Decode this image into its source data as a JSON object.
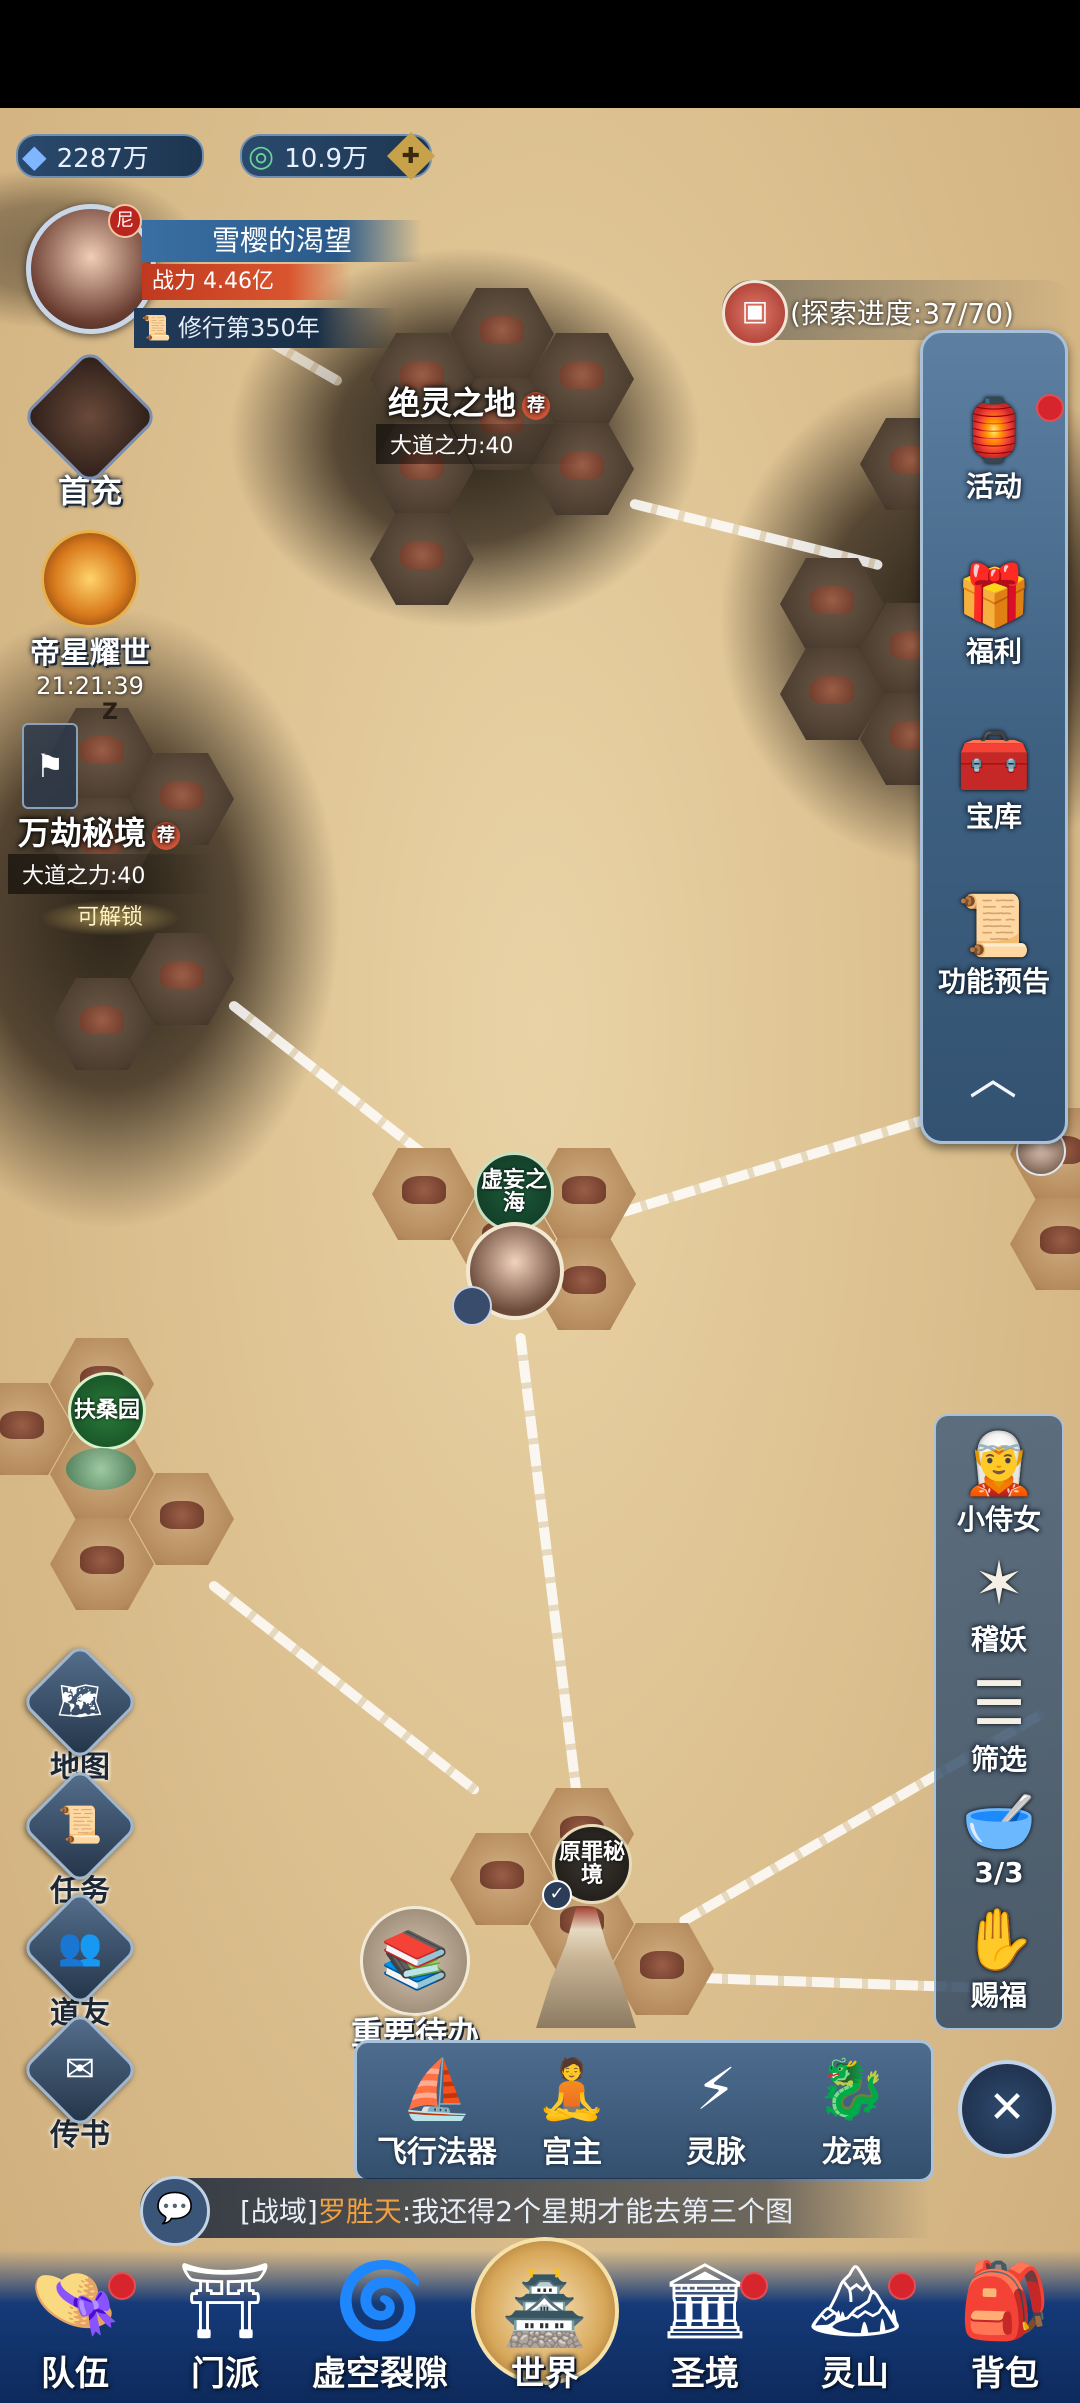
{
  "currency": {
    "crystal_icon": "blue-crystal-icon",
    "crystal_amount": "2287万",
    "jade_icon": "green-jade-icon",
    "jade_amount": "10.9万"
  },
  "player": {
    "name": "雪樱的渴望",
    "power_label": "战力",
    "power_value": "4.46亿",
    "cultivation": "修行第350年",
    "badge": "尼"
  },
  "left_menu": [
    {
      "label": "首充",
      "icon": "hero-portrait-icon"
    },
    {
      "label": "帝星耀世",
      "icon": "sun-emblem-icon",
      "timer": "21:21:39"
    }
  ],
  "explore": {
    "progress_text": "(探索进度:37/70)",
    "icon": "treasure-box-icon"
  },
  "right_panel": [
    {
      "label": "活动",
      "icon": "lantern-icon"
    },
    {
      "label": "福利",
      "icon": "gift-pavilion-icon"
    },
    {
      "label": "宝库",
      "icon": "treasure-chest-icon"
    },
    {
      "label": "功能预告",
      "icon": "scroll-icon"
    }
  ],
  "regions": {
    "jueling": {
      "name": "绝灵之地",
      "badge": "荐",
      "req": "大道之力:40"
    },
    "wanjie": {
      "name": "万劫秘境",
      "badge": "荐",
      "req": "大道之力:40",
      "status": "可解锁",
      "z": "Z"
    },
    "xuwang": {
      "name": "虚妄之海"
    },
    "fusang": {
      "name": "扶桑园"
    },
    "yuanzui": {
      "name": "原罪秘境"
    }
  },
  "right_tools": [
    {
      "label": "小侍女",
      "icon": "maid-icon"
    },
    {
      "label": "稽妖",
      "icon": "demon-mark-icon"
    },
    {
      "label": "筛选",
      "icon": "filter-icon"
    },
    {
      "label": "3/3",
      "icon": "bowl-icon"
    },
    {
      "label": "赐福",
      "icon": "blessing-hand-icon"
    }
  ],
  "left_tools": [
    {
      "label": "地图",
      "icon": "map-icon"
    },
    {
      "label": "任务",
      "icon": "scroll-task-icon"
    },
    {
      "label": "道友",
      "icon": "friends-icon"
    },
    {
      "label": "传书",
      "icon": "letter-icon"
    }
  ],
  "todo": {
    "label": "重要待办",
    "icon": "books-icon"
  },
  "bottom_tray": [
    {
      "label": "飞行法器",
      "icon": "flying-boat-icon"
    },
    {
      "label": "宫主",
      "icon": "palace-master-icon"
    },
    {
      "label": "灵脉",
      "icon": "spirit-vein-icon"
    },
    {
      "label": "龙魂",
      "icon": "dragon-icon"
    }
  ],
  "chat": {
    "channel": "[战域]",
    "speaker": "罗胜天",
    "message": ":我还得2个星期才能去第三个图"
  },
  "bottom_nav": [
    {
      "label": "队伍",
      "icon": "straw-hat-icon",
      "dot": true
    },
    {
      "label": "门派",
      "icon": "temple-icon",
      "dot": false
    },
    {
      "label": "虚空裂隙",
      "icon": "vortex-icon",
      "dot": false
    },
    {
      "label": "世界",
      "icon": "world-pagoda-icon",
      "dot": false,
      "active": true
    },
    {
      "label": "圣境",
      "icon": "palace-icon",
      "dot": true
    },
    {
      "label": "灵山",
      "icon": "mountain-icon",
      "dot": true
    },
    {
      "label": "背包",
      "icon": "backpack-icon",
      "dot": false
    }
  ]
}
